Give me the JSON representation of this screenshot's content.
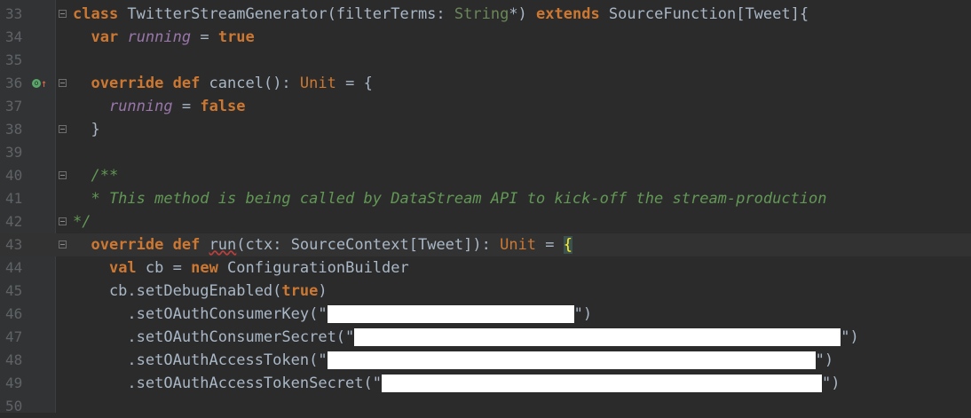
{
  "editor": {
    "lines": [
      {
        "num": "33",
        "tokens": [
          {
            "t": "kw",
            "v": "class"
          },
          {
            "t": "id",
            "v": " TwitterStreamGenerator(filterTerms: "
          },
          {
            "t": "param-type",
            "v": "String"
          },
          {
            "t": "id",
            "v": "*) "
          },
          {
            "t": "kw",
            "v": "extends"
          },
          {
            "t": "id",
            "v": " SourceFunction[Tweet]{"
          }
        ]
      },
      {
        "num": "34",
        "tokens": [
          {
            "t": "id",
            "v": "  "
          },
          {
            "t": "kw",
            "v": "var"
          },
          {
            "t": "id",
            "v": " "
          },
          {
            "t": "field",
            "v": "running"
          },
          {
            "t": "id",
            "v": " = "
          },
          {
            "t": "kw",
            "v": "true"
          }
        ]
      },
      {
        "num": "35",
        "tokens": []
      },
      {
        "num": "36",
        "tokens": [
          {
            "t": "id",
            "v": "  "
          },
          {
            "t": "kw",
            "v": "override def"
          },
          {
            "t": "id",
            "v": " cancel(): "
          },
          {
            "t": "ty",
            "v": "Unit"
          },
          {
            "t": "id",
            "v": " = {"
          }
        ]
      },
      {
        "num": "37",
        "tokens": [
          {
            "t": "id",
            "v": "    "
          },
          {
            "t": "field",
            "v": "running"
          },
          {
            "t": "id",
            "v": " = "
          },
          {
            "t": "kw",
            "v": "false"
          }
        ]
      },
      {
        "num": "38",
        "tokens": [
          {
            "t": "id",
            "v": "  }"
          }
        ]
      },
      {
        "num": "39",
        "tokens": []
      },
      {
        "num": "40",
        "tokens": [
          {
            "t": "comment",
            "v": "  /**"
          }
        ]
      },
      {
        "num": "41",
        "tokens": [
          {
            "t": "comment",
            "v": "  * This method is being called by DataStream API to kick-off the stream-production"
          }
        ]
      },
      {
        "num": "42",
        "tokens": [
          {
            "t": "comment",
            "v": "*/"
          }
        ]
      },
      {
        "num": "43",
        "tokens": [
          {
            "t": "id",
            "v": "  "
          },
          {
            "t": "kw",
            "v": "override def"
          },
          {
            "t": "id",
            "v": " "
          },
          {
            "t": "squiggle",
            "v": "run"
          },
          {
            "t": "id",
            "v": "(ctx: SourceContext[Tweet]): "
          },
          {
            "t": "ty",
            "v": "Unit"
          },
          {
            "t": "id",
            "v": " = "
          },
          {
            "t": "brace-hl",
            "v": "{"
          }
        ]
      },
      {
        "num": "44",
        "tokens": [
          {
            "t": "id",
            "v": "    "
          },
          {
            "t": "kw",
            "v": "val"
          },
          {
            "t": "id",
            "v": " cb = "
          },
          {
            "t": "kw",
            "v": "new"
          },
          {
            "t": "id",
            "v": " ConfigurationBuilder"
          }
        ]
      },
      {
        "num": "45",
        "tokens": [
          {
            "t": "id",
            "v": "    cb.setDebugEnabled("
          },
          {
            "t": "kw",
            "v": "true"
          },
          {
            "t": "id",
            "v": ")"
          }
        ]
      },
      {
        "num": "46",
        "tokens": [
          {
            "t": "id",
            "v": "      .setOAuthConsumerKey(\""
          },
          {
            "t": "redact",
            "v": "",
            "w": 278
          },
          {
            "t": "id",
            "v": "\")"
          }
        ]
      },
      {
        "num": "47",
        "tokens": [
          {
            "t": "id",
            "v": "      .setOAuthConsumerSecret(\""
          },
          {
            "t": "redact",
            "v": "",
            "w": 548
          },
          {
            "t": "id",
            "v": "\")"
          }
        ]
      },
      {
        "num": "48",
        "tokens": [
          {
            "t": "id",
            "v": "      .setOAuthAccessToken(\""
          },
          {
            "t": "redact",
            "v": "",
            "w": 550
          },
          {
            "t": "id",
            "v": "\")"
          }
        ]
      },
      {
        "num": "49",
        "tokens": [
          {
            "t": "id",
            "v": "      .setOAuthAccessTokenSecret(\""
          },
          {
            "t": "redact",
            "v": "",
            "w": 496
          },
          {
            "t": "id",
            "v": "\")"
          }
        ]
      },
      {
        "num": "50",
        "tokens": []
      }
    ],
    "current_line": "43",
    "override_marker_line": "36",
    "fold_lines": [
      "33",
      "36",
      "38",
      "40",
      "42",
      "43"
    ],
    "colors": {
      "background": "#2b2b2b",
      "keyword": "#cc7832",
      "field": "#9876aa",
      "comment": "#629755",
      "string_type": "#6a8759",
      "default": "#a9b7c6"
    }
  }
}
